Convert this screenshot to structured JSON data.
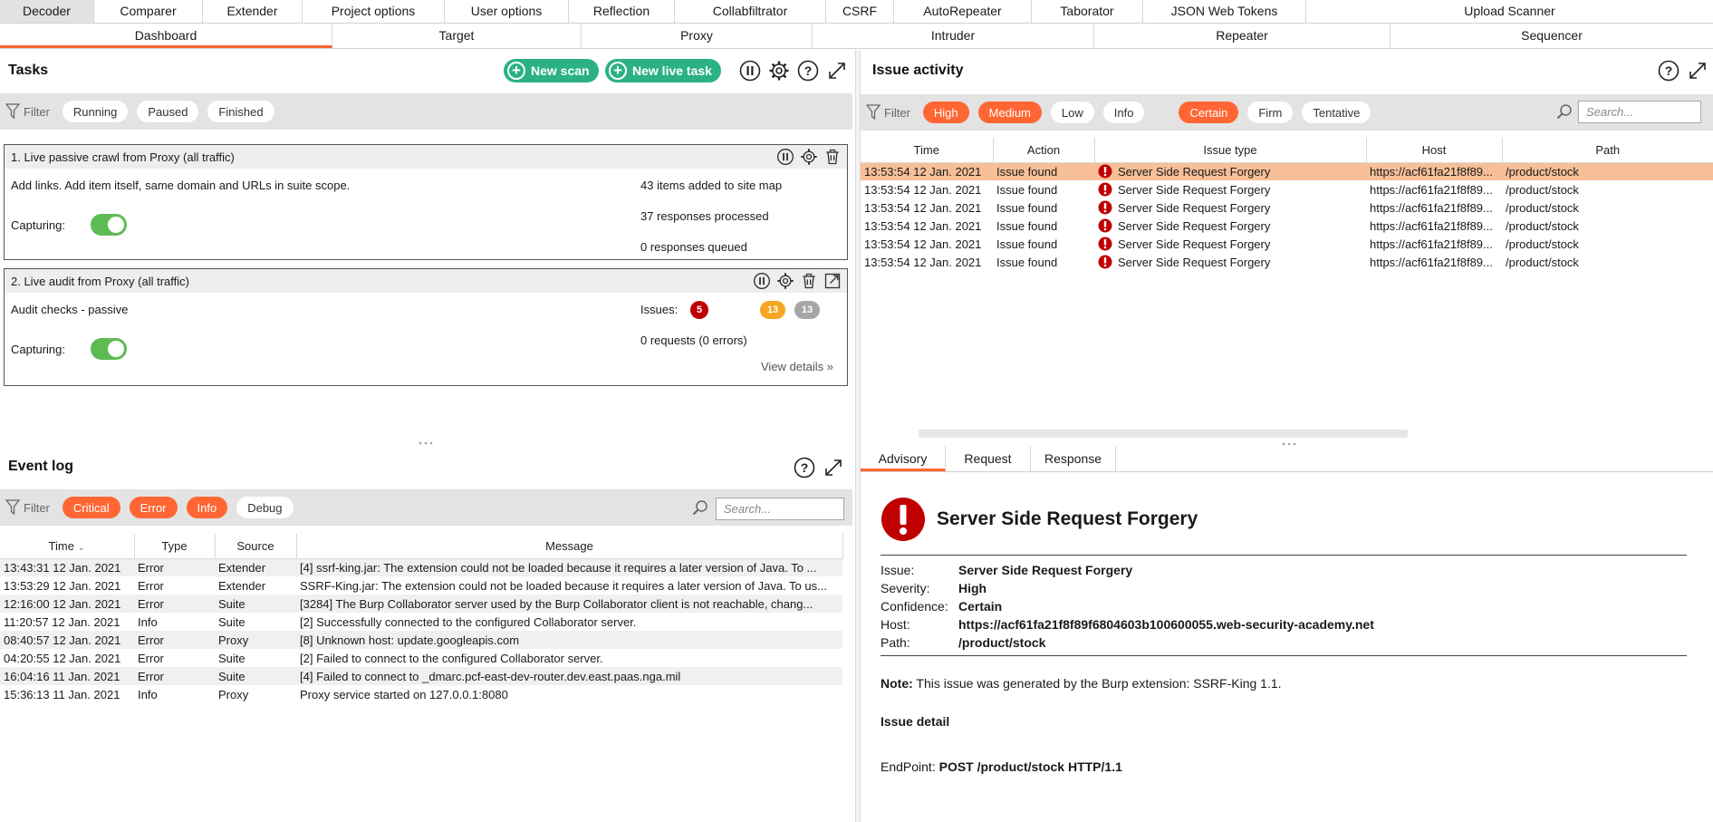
{
  "top_tabs": [
    "Decoder",
    "Comparer",
    "Extender",
    "Project options",
    "User options",
    "Reflection",
    "Collabfiltrator",
    "CSRF",
    "AutoRepeater",
    "Taborator",
    "JSON Web Tokens",
    "Upload Scanner"
  ],
  "sub_tabs": [
    "Dashboard",
    "Target",
    "Proxy",
    "Intruder",
    "Repeater",
    "Sequencer"
  ],
  "tasks": {
    "title": "Tasks",
    "new_scan": "New scan",
    "new_live_task": "New live task",
    "filter_label": "Filter",
    "filters": [
      "Running",
      "Paused",
      "Finished"
    ],
    "task1": {
      "title": "1. Live passive crawl from Proxy (all traffic)",
      "desc": "Add links. Add item itself, same domain and URLs in suite scope.",
      "capturing": "Capturing:",
      "stat1": "43 items added to site map",
      "stat2": "37 responses processed",
      "stat3": "0 responses queued"
    },
    "task2": {
      "title": "2. Live audit from Proxy (all traffic)",
      "desc": "Audit checks - passive",
      "capturing": "Capturing:",
      "issues_label": "Issues:",
      "badge_high": "5",
      "badge_medium": "13",
      "badge_low": "13",
      "requests": "0 requests (0 errors)",
      "view_details": "View details"
    }
  },
  "issues": {
    "title": "Issue activity",
    "filter_label": "Filter",
    "severity_filters": [
      "High",
      "Medium",
      "Low",
      "Info"
    ],
    "confidence_filters": [
      "Certain",
      "Firm",
      "Tentative"
    ],
    "search_placeholder": "Search...",
    "columns": [
      "Time",
      "Action",
      "Issue type",
      "Host",
      "Path"
    ],
    "rows": [
      {
        "time": "13:53:54 12 Jan. 2021",
        "action": "Issue found",
        "type": "Server Side Request Forgery",
        "host": "https://acf61fa21f8f89...",
        "path": "/product/stock"
      },
      {
        "time": "13:53:54 12 Jan. 2021",
        "action": "Issue found",
        "type": "Server Side Request Forgery",
        "host": "https://acf61fa21f8f89...",
        "path": "/product/stock"
      },
      {
        "time": "13:53:54 12 Jan. 2021",
        "action": "Issue found",
        "type": "Server Side Request Forgery",
        "host": "https://acf61fa21f8f89...",
        "path": "/product/stock"
      },
      {
        "time": "13:53:54 12 Jan. 2021",
        "action": "Issue found",
        "type": "Server Side Request Forgery",
        "host": "https://acf61fa21f8f89...",
        "path": "/product/stock"
      },
      {
        "time": "13:53:54 12 Jan. 2021",
        "action": "Issue found",
        "type": "Server Side Request Forgery",
        "host": "https://acf61fa21f8f89...",
        "path": "/product/stock"
      },
      {
        "time": "13:53:54 12 Jan. 2021",
        "action": "Issue found",
        "type": "Server Side Request Forgery",
        "host": "https://acf61fa21f8f89...",
        "path": "/product/stock"
      }
    ]
  },
  "events": {
    "title": "Event log",
    "filter_label": "Filter",
    "filters": [
      "Critical",
      "Error",
      "Info",
      "Debug"
    ],
    "search_placeholder": "Search...",
    "columns": [
      "Time",
      "Type",
      "Source",
      "Message"
    ],
    "rows": [
      {
        "time": "13:43:31 12 Jan. 2021",
        "type": "Error",
        "source": "Extender",
        "message": "[4]  ssrf-king.jar: The extension could not be loaded because it requires a later version of Java. To ..."
      },
      {
        "time": "13:53:29 12 Jan. 2021",
        "type": "Error",
        "source": "Extender",
        "message": "SSRF-King.jar: The extension could not be loaded because it requires a later version of Java. To us..."
      },
      {
        "time": "12:16:00 12 Jan. 2021",
        "type": "Error",
        "source": "Suite",
        "message": "[3284]  The Burp Collaborator server used by the Burp Collaborator client is not reachable, chang..."
      },
      {
        "time": "11:20:57 12 Jan. 2021",
        "type": "Info",
        "source": "Suite",
        "message": "[2]  Successfully connected to the configured Collaborator server."
      },
      {
        "time": "08:40:57 12 Jan. 2021",
        "type": "Error",
        "source": "Proxy",
        "message": "[8]  Unknown host: update.googleapis.com"
      },
      {
        "time": "04:20:55 12 Jan. 2021",
        "type": "Error",
        "source": "Suite",
        "message": "[2]  Failed to connect to the configured Collaborator server."
      },
      {
        "time": "16:04:16 11 Jan. 2021",
        "type": "Error",
        "source": "Suite",
        "message": "[4]  Failed to connect to _dmarc.pcf-east-dev-router.dev.east.paas.nga.mil"
      },
      {
        "time": "15:36:13 11 Jan. 2021",
        "type": "Info",
        "source": "Proxy",
        "message": "Proxy service started on 127.0.0.1:8080"
      }
    ]
  },
  "advisory": {
    "tabs": [
      "Advisory",
      "Request",
      "Response"
    ],
    "title": "Server Side Request Forgery",
    "issue_label": "Issue:",
    "issue": "Server Side Request Forgery",
    "severity_label": "Severity:",
    "severity": "High",
    "confidence_label": "Confidence:",
    "confidence": "Certain",
    "host_label": "Host:",
    "host": "https://acf61fa21f8f89f6804603b100600055.web-security-academy.net",
    "path_label": "Path:",
    "path": "/product/stock",
    "note_label": "Note:",
    "note": " This issue was generated by the Burp extension: SSRF-King 1.1.",
    "detail_heading": "Issue detail",
    "endpoint_label": "EndPoint: ",
    "endpoint": "POST /product/stock HTTP/1.1"
  },
  "colors": {
    "accent": "#ff6633",
    "green": "#2bb185",
    "toggle": "#5dbb53",
    "high": "#c00000",
    "medium": "#f5a623",
    "low": "#a6a6a6",
    "selected_row": "#f7bf98"
  }
}
